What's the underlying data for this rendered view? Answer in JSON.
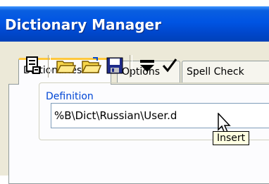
{
  "window": {
    "title": "Dictionary Manager"
  },
  "tabs": [
    {
      "label": "Dictionaries",
      "active": true
    },
    {
      "label": "Options",
      "active": false
    },
    {
      "label": "Spell Check",
      "active": false
    }
  ],
  "toolbar": {
    "buttons": [
      {
        "icon": "properties-icon"
      },
      {
        "icon": "open-folder-icon"
      },
      {
        "icon": "open-folder-icon"
      },
      {
        "icon": "save-icon"
      },
      {
        "icon": "insert-icon",
        "tooltip": "Insert"
      },
      {
        "icon": "check-icon"
      }
    ]
  },
  "definition": {
    "group_label": "Definition",
    "path_value": "%B\\Dict\\Russian\\User.dic",
    "path_visible": "%B\\Dict\\Russian\\User.d"
  },
  "tooltip": {
    "text": "Insert"
  },
  "colors": {
    "titlebar": "#0054e3",
    "tab_highlight": "#ffc83c",
    "group_label": "#0046d5",
    "tooltip_bg": "#ffffe1"
  }
}
